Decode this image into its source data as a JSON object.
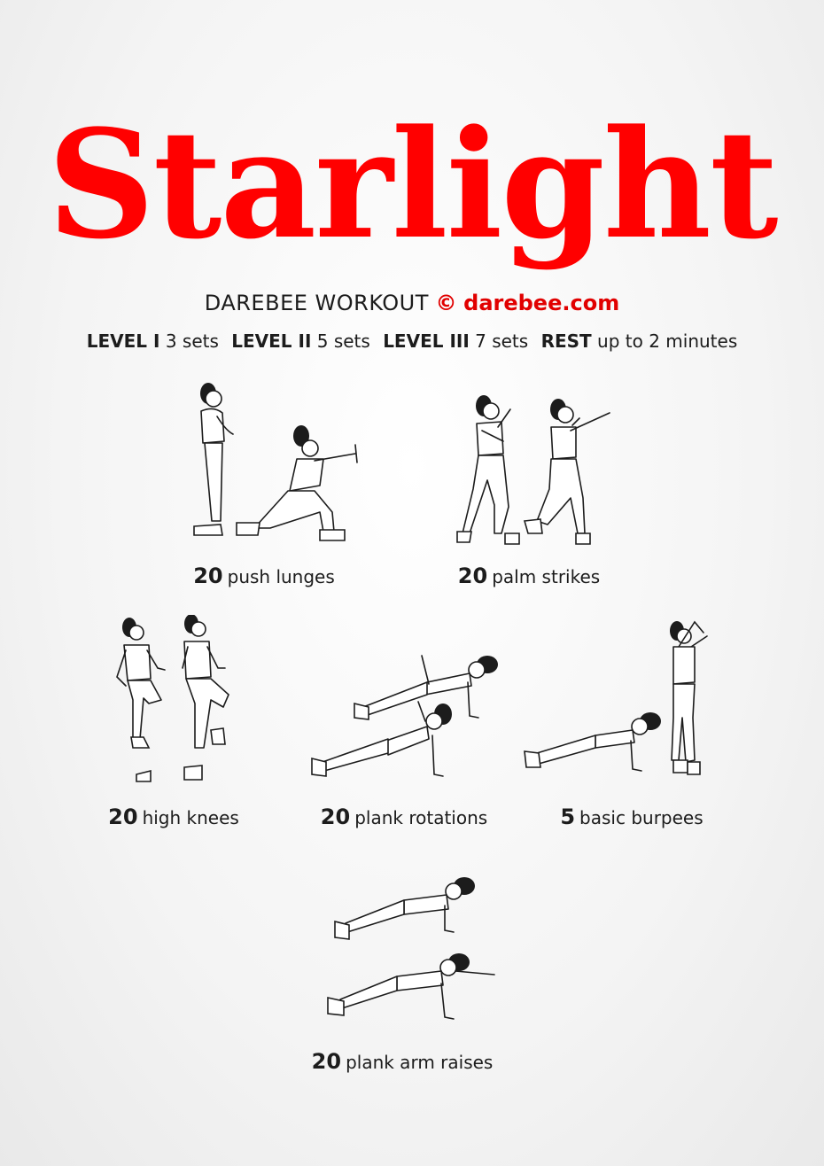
{
  "title": "Starlight",
  "subtitle": {
    "brand": "DAREBEE WORKOUT",
    "copyright_symbol": "©",
    "site": "darebee.com"
  },
  "levels": [
    {
      "label": "LEVEL I",
      "value": "3 sets"
    },
    {
      "label": "LEVEL II",
      "value": "5 sets"
    },
    {
      "label": "LEVEL III",
      "value": "7 sets"
    },
    {
      "label": "REST",
      "value": "up to 2 minutes"
    }
  ],
  "exercises": [
    {
      "count": "20",
      "name": "push lunges"
    },
    {
      "count": "20",
      "name": "palm strikes"
    },
    {
      "count": "20",
      "name": "high knees"
    },
    {
      "count": "20",
      "name": "plank rotations"
    },
    {
      "count": "5",
      "name": "basic burpees"
    },
    {
      "count": "20",
      "name": "plank arm raises"
    }
  ]
}
